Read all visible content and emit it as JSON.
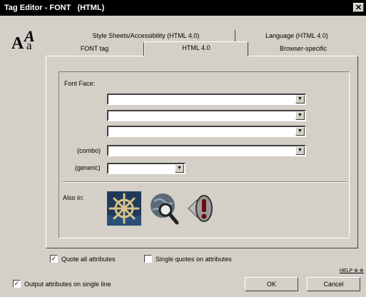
{
  "window": {
    "title": "Tag Editor - FONT   (HTML)",
    "close_glyph": "✕"
  },
  "logo": {
    "a1": "A",
    "a2": "A",
    "a3": "a"
  },
  "tabs": {
    "row_back": [
      {
        "label": "Style Sheets/Accessibility (HTML 4.0)"
      },
      {
        "label": "Language (HTML 4.0)"
      }
    ],
    "row_front": [
      {
        "label": "FONT tag"
      },
      {
        "label": "HTML 4.0",
        "active": true
      },
      {
        "label": "Browser-specific"
      }
    ]
  },
  "form": {
    "font_face_label": "Font Face:",
    "combo_label": "(combo)",
    "generic_label": "(generic)",
    "font_face_1": "",
    "font_face_2": "",
    "font_face_3": "",
    "combo_value": "",
    "generic_value": "",
    "dropdown_glyph": "▼",
    "also_in_label": "Also in:"
  },
  "also_in_icons": [
    "ship-wheel-icon",
    "globe-magnifier-icon",
    "info-icon"
  ],
  "options": {
    "quote_all": {
      "label": "Quote all attributes",
      "checked": true
    },
    "single_quotes": {
      "label": "Single quotes on attributes",
      "checked": false
    },
    "output_single_line": {
      "label": "Output attributes on single line",
      "checked": true
    },
    "check_glyph": "✓"
  },
  "buttons": {
    "help": "HELP ⊗ ⊕",
    "ok": "OK",
    "cancel": "Cancel"
  }
}
